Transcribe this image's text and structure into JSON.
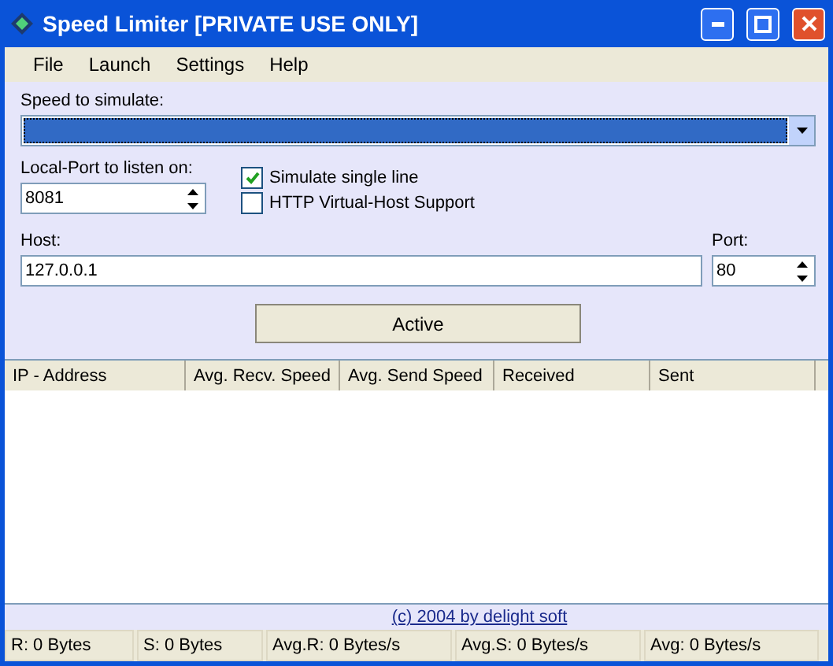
{
  "window": {
    "title": "Speed Limiter [PRIVATE USE ONLY]"
  },
  "menu": [
    "File",
    "Launch",
    "Settings",
    "Help"
  ],
  "speed": {
    "label": "Speed to simulate:"
  },
  "local_port": {
    "label": "Local-Port to listen on:",
    "value": "8081"
  },
  "options": [
    {
      "label": "Simulate single line",
      "checked": true
    },
    {
      "label": "HTTP Virtual-Host Support",
      "checked": false
    }
  ],
  "host": {
    "label": "Host:",
    "value": "127.0.0.1"
  },
  "port": {
    "label": "Port:",
    "value": "80"
  },
  "active_button": "Active",
  "table": {
    "columns": [
      "IP - Address",
      "Avg. Recv. Speed",
      "Avg. Send Speed",
      "Received",
      "Sent"
    ]
  },
  "copyright": "(c) 2004 by delight soft",
  "status_bar": [
    "R: 0 Bytes",
    "S: 0 Bytes",
    "Avg.R: 0 Bytes/s",
    "Avg.S: 0 Bytes/s",
    "Avg: 0 Bytes/s"
  ]
}
